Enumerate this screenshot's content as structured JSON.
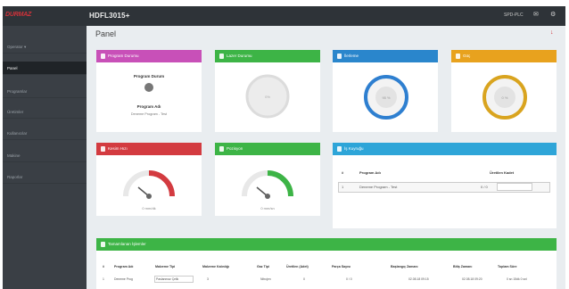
{
  "topbar": {
    "logo": "DURMAZ",
    "title": "HDFL3015+",
    "user_menu": "SPD-PLC",
    "bell_glyph": "✉",
    "settings_glyph": "⚙"
  },
  "sidebar": {
    "items": [
      {
        "label": "Operator ▾"
      },
      {
        "label": "Panel"
      },
      {
        "label": "Programlar"
      },
      {
        "label": "Üretimler"
      },
      {
        "label": "Kullanıcılar"
      },
      {
        "label": "Makine"
      },
      {
        "label": "Raporlar"
      }
    ]
  },
  "main": {
    "page_title": "Panel",
    "top_arrow": "↓"
  },
  "cards": {
    "program": {
      "header": "Program Durumu",
      "status_label": "Program Durum",
      "name_label": "Program Adı",
      "name_value": "Deneme Program - Test"
    },
    "laser": {
      "header": "Lazer Durumu",
      "value": "0%"
    },
    "progress": {
      "header": "İlerleme",
      "value": "95 %"
    },
    "power": {
      "header": "Güç",
      "value": "0 %"
    },
    "speed1": {
      "header": "Kesim Hızı",
      "value": "0 mm/dk"
    },
    "speed2": {
      "header": "Pozisyon",
      "value": "0 mm/sn"
    },
    "queue": {
      "header": "İş Kuyruğu",
      "col_index": "#",
      "col_name": "Program Adı",
      "col_count": "Üretilen Kadet",
      "rows": [
        {
          "index": "1",
          "name": "Deneme Program - Test",
          "count": "0 / 0"
        }
      ]
    },
    "history": {
      "header": "Tamamlanan İşlemler",
      "columns": [
        "#",
        "Program Adı",
        "Malzeme Tipi",
        "Malzeme Kalınlığı",
        "Gaz Tipi",
        "Üretilen (Adet)",
        "Parça Sayısı",
        "Başlangıç Zamanı",
        "Bitiş Zamanı",
        "Toplam Süre"
      ],
      "rows": [
        {
          "cells": [
            "1",
            "Deneme Prog",
            "Paslanmaz Çelik",
            "3",
            "",
            "Nitrojen",
            "0",
            "0 / 0",
            "02.08.18 09:15",
            "02.08.18 09:20",
            "0 sn 15dk 0 snl"
          ]
        }
      ]
    }
  },
  "colors": {
    "magenta": "#c850b8",
    "green": "#3db446",
    "blue": "#2a86cc",
    "orange": "#e8a21e",
    "red": "#d33b40",
    "cyan": "#2ea5d8",
    "ring_blue": "#2e7fd0",
    "ring_gold": "#d9a41f",
    "topbar": "#2e3338"
  }
}
